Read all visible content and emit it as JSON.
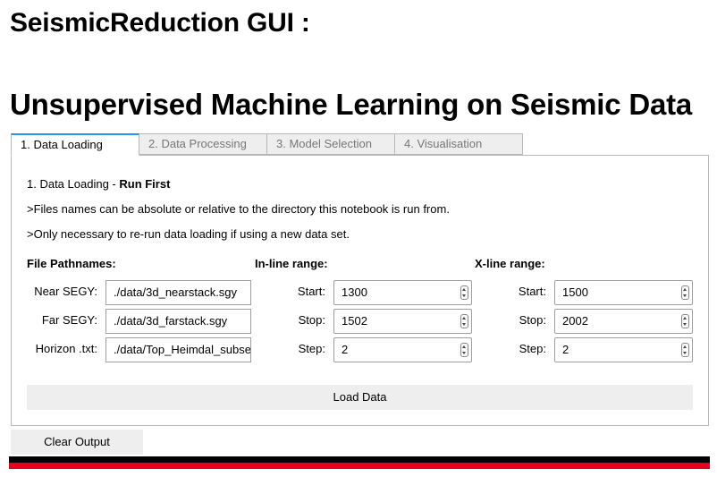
{
  "header": {
    "title": "SeismicReduction GUI :",
    "subtitle": "Unsupervised Machine Learning on Seismic Data"
  },
  "tabs": [
    {
      "label": "1. Data Loading",
      "active": true
    },
    {
      "label": "2. Data Processing",
      "active": false
    },
    {
      "label": "3. Model Selection",
      "active": false
    },
    {
      "label": "4. Visualisation",
      "active": false
    }
  ],
  "panel": {
    "heading_prefix": "1. Data Loading - ",
    "heading_bold": "Run First",
    "note1": ">Files names can be absolute or relative to the directory this notebook is run from.",
    "note2": ">Only necessary to re-run data loading if using a new data set.",
    "files": {
      "section_label": "File Pathnames:",
      "near_label": "Near SEGY:",
      "near_value": "./data/3d_nearstack.sgy",
      "far_label": "Far SEGY:",
      "far_value": "./data/3d_farstack.sgy",
      "horizon_label": "Horizon .txt:",
      "horizon_value": "./data/Top_Heimdal_subset.txt"
    },
    "inline": {
      "section_label": "In-line range:",
      "start_label": "Start:",
      "start_value": "1300",
      "stop_label": "Stop:",
      "stop_value": "1502",
      "step_label": "Step:",
      "step_value": "2"
    },
    "xline": {
      "section_label": "X-line range:",
      "start_label": "Start:",
      "start_value": "1500",
      "stop_label": "Stop:",
      "stop_value": "2002",
      "step_label": "Step:",
      "step_value": "2"
    },
    "load_button": "Load Data"
  },
  "footer": {
    "clear_button": "Clear Output"
  },
  "colors": {
    "tab_accent": "#2196f3",
    "bar_top": "#000000",
    "bar_bottom": "#e8001c"
  }
}
